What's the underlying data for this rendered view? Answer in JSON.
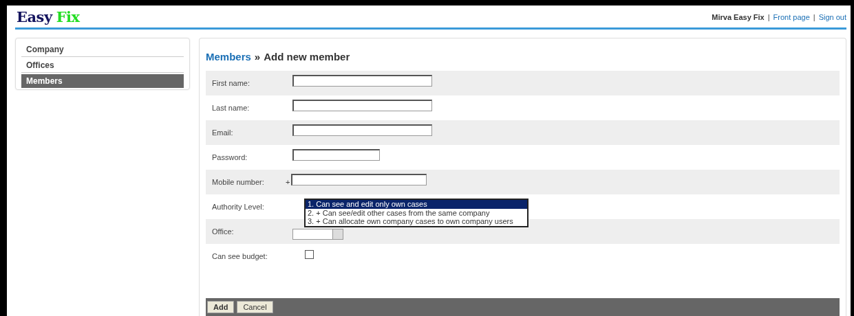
{
  "header": {
    "logo": [
      "Easy",
      "Fix"
    ],
    "user": "Mirva Easy Fix",
    "separators": [
      "|",
      "|"
    ],
    "links": [
      "Front page",
      "Sign out"
    ]
  },
  "sidebar": {
    "items": [
      {
        "label": "Company",
        "selected": false
      },
      {
        "label": "Offices",
        "selected": false
      },
      {
        "label": "Members",
        "selected": true
      }
    ]
  },
  "breadcrumb": {
    "link": "Members",
    "separator": "»",
    "title": "Add new member"
  },
  "form": {
    "fields": [
      {
        "kind": "text",
        "label": "First name:"
      },
      {
        "kind": "text",
        "label": "Last name:"
      },
      {
        "kind": "text",
        "label": "Email:"
      },
      {
        "kind": "password",
        "label": "Password:"
      },
      {
        "kind": "phone",
        "label": "Mobile number:",
        "prefix": "+"
      },
      {
        "kind": "listbox",
        "label": "Authority Level:",
        "options": [
          {
            "label": "1. Can see and edit only own cases",
            "selected": true
          },
          {
            "label": "2. + Can see/edit other cases from the same company",
            "selected": false
          },
          {
            "label": "3. + Can allocate own company cases to own company users",
            "selected": false
          }
        ]
      },
      {
        "kind": "select",
        "label": "Office:"
      },
      {
        "kind": "checkbox",
        "label": "Can see budget:",
        "checked": false
      }
    ]
  },
  "buttons": [
    "Add",
    "Cancel"
  ]
}
